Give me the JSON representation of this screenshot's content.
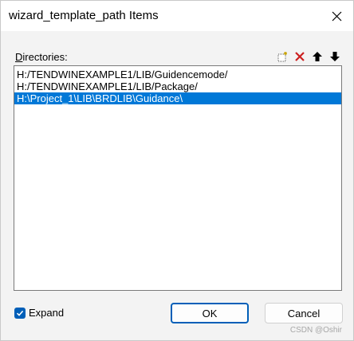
{
  "window": {
    "title": "wizard_template_path Items",
    "close_icon": "close-icon"
  },
  "directories": {
    "label_mnemonic": "D",
    "label_rest": "irectories:",
    "toolbar": [
      {
        "name": "new-folder-icon",
        "color": "#c8a200"
      },
      {
        "name": "delete-icon",
        "color": "#cc1f1f"
      },
      {
        "name": "move-up-icon",
        "color": "#000000"
      },
      {
        "name": "move-down-icon",
        "color": "#000000"
      }
    ],
    "items": [
      "H:/TENDWINEXAMPLE1/LIB/Guidencemode/",
      "H:/TENDWINEXAMPLE1/LIB/Package/",
      "H:\\Project_1\\LIB\\BRDLIB\\Guidance\\"
    ],
    "selected_index": 2
  },
  "footer": {
    "expand_label": "Expand",
    "expand_checked": true,
    "ok_label": "OK",
    "cancel_label": "Cancel",
    "watermark": "CSDN @Oshir"
  },
  "colors": {
    "accent": "#0078d7",
    "checkbox": "#005fb8"
  }
}
